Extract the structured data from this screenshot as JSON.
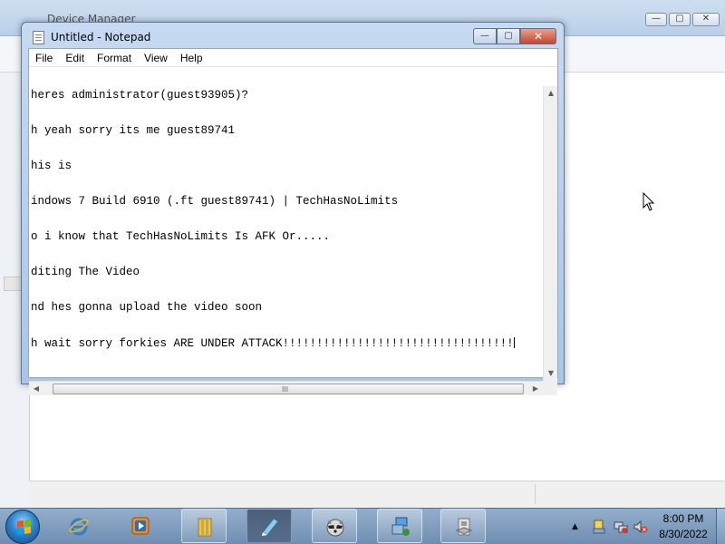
{
  "background_window": {
    "title": "Device Manager",
    "sys_minimize": "—",
    "sys_maximize": "▢",
    "sys_close": "✕"
  },
  "notepad": {
    "title": "Untitled - Notepad",
    "btn_minimize": "—",
    "btn_maximize": "▢",
    "btn_close": "✕",
    "menu": [
      "File",
      "Edit",
      "Format",
      "View",
      "Help"
    ],
    "lines": [
      "heres administrator(guest93905)?",
      "h yeah sorry its me guest89741",
      "his is",
      "indows 7 Build 6910 (.ft guest89741) | TechHasNoLimits",
      "o i know that TechHasNoLimits Is AFK Or.....",
      "diting The Video",
      "nd hes gonna upload the video soon",
      "h wait sorry forkies ARE UNDER ATTACK!!!!!!!!!!!!!!!!!!!!!!!!!!!!!!!!!!"
    ],
    "hscroll_grip": "III",
    "arrow_up": "▲",
    "arrow_down": "▼",
    "arrow_left": "◀",
    "arrow_right": "▶"
  },
  "taskbar": {
    "items": [
      {
        "name": "internet-explorer",
        "icon": "ie-icon"
      },
      {
        "name": "media-player",
        "icon": "media-player-icon"
      },
      {
        "name": "explorer",
        "icon": "folder-icon"
      },
      {
        "name": "notepad",
        "icon": "notepad-icon"
      },
      {
        "name": "raccoon-app",
        "icon": "raccoon-icon"
      },
      {
        "name": "device-manager",
        "icon": "device-manager-icon"
      },
      {
        "name": "installer",
        "icon": "installer-icon"
      }
    ],
    "tray_arrow": "▲",
    "clock_time": "8:00 PM",
    "clock_date": "8/30/2022"
  },
  "colors": {
    "accent": "#1f5fa8",
    "taskbar": "#7f9cc0",
    "close_button": "#c4452e"
  }
}
